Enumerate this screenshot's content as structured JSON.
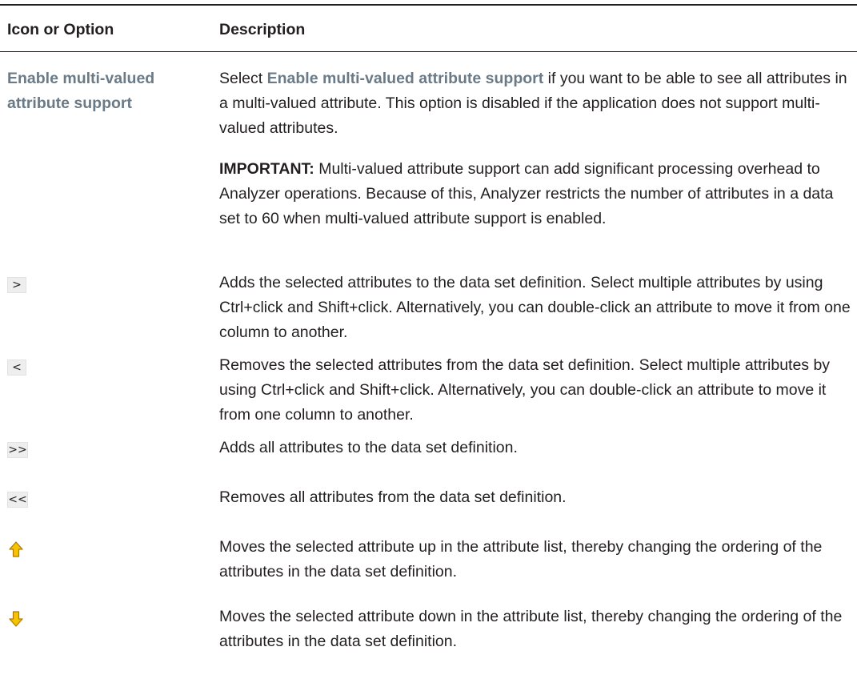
{
  "table": {
    "header": {
      "col1": "Icon or Option",
      "col2": "Description"
    },
    "rows": [
      {
        "option": "Enable multi-valued attribute support",
        "desc_prefix": "Select ",
        "desc_link": "Enable multi-valued attribute support",
        "desc_suffix": " if you want to be able to see all attributes in a multi-valued attribute. This option is disabled if the application does not support multi-valued attributes.",
        "important_label": "IMPORTANT:",
        "important_text": " Multi-valued attribute support can add significant processing overhead to Analyzer operations. Because of this, Analyzer restricts the number of attributes in a data set to 60 when multi-valued attribute support is enabled."
      },
      {
        "icon": "add-selected-icon",
        "icon_glyph": ">",
        "description": "Adds the selected attributes to the data set definition. Select multiple attributes by using Ctrl+click and Shift+click. Alternatively, you can double-click an attribute to move it from one column to another."
      },
      {
        "icon": "remove-selected-icon",
        "icon_glyph": "<",
        "description": "Removes the selected attributes from the data set definition. Select multiple attributes by using Ctrl+click and Shift+click. Alternatively, you can double-click an attribute to move it from one column to another."
      },
      {
        "icon": "add-all-icon",
        "icon_glyph": ">>",
        "description": "Adds all attributes to the data set definition."
      },
      {
        "icon": "remove-all-icon",
        "icon_glyph": "<<",
        "description": "Removes all attributes from the data set definition."
      },
      {
        "icon": "move-up-arrow-icon",
        "description": "Moves the selected attribute up in the attribute list, thereby changing the ordering of the attributes in the data set definition."
      },
      {
        "icon": "move-down-arrow-icon",
        "description": "Moves the selected attribute down in the attribute list, thereby changing the ordering of the attributes in the data set definition."
      }
    ]
  },
  "colors": {
    "text": "#231f20",
    "option_link": "#6a7a86",
    "icon_bg": "#eeeeee",
    "arrow_fill": "#f5c400",
    "arrow_stroke": "#b07800"
  }
}
